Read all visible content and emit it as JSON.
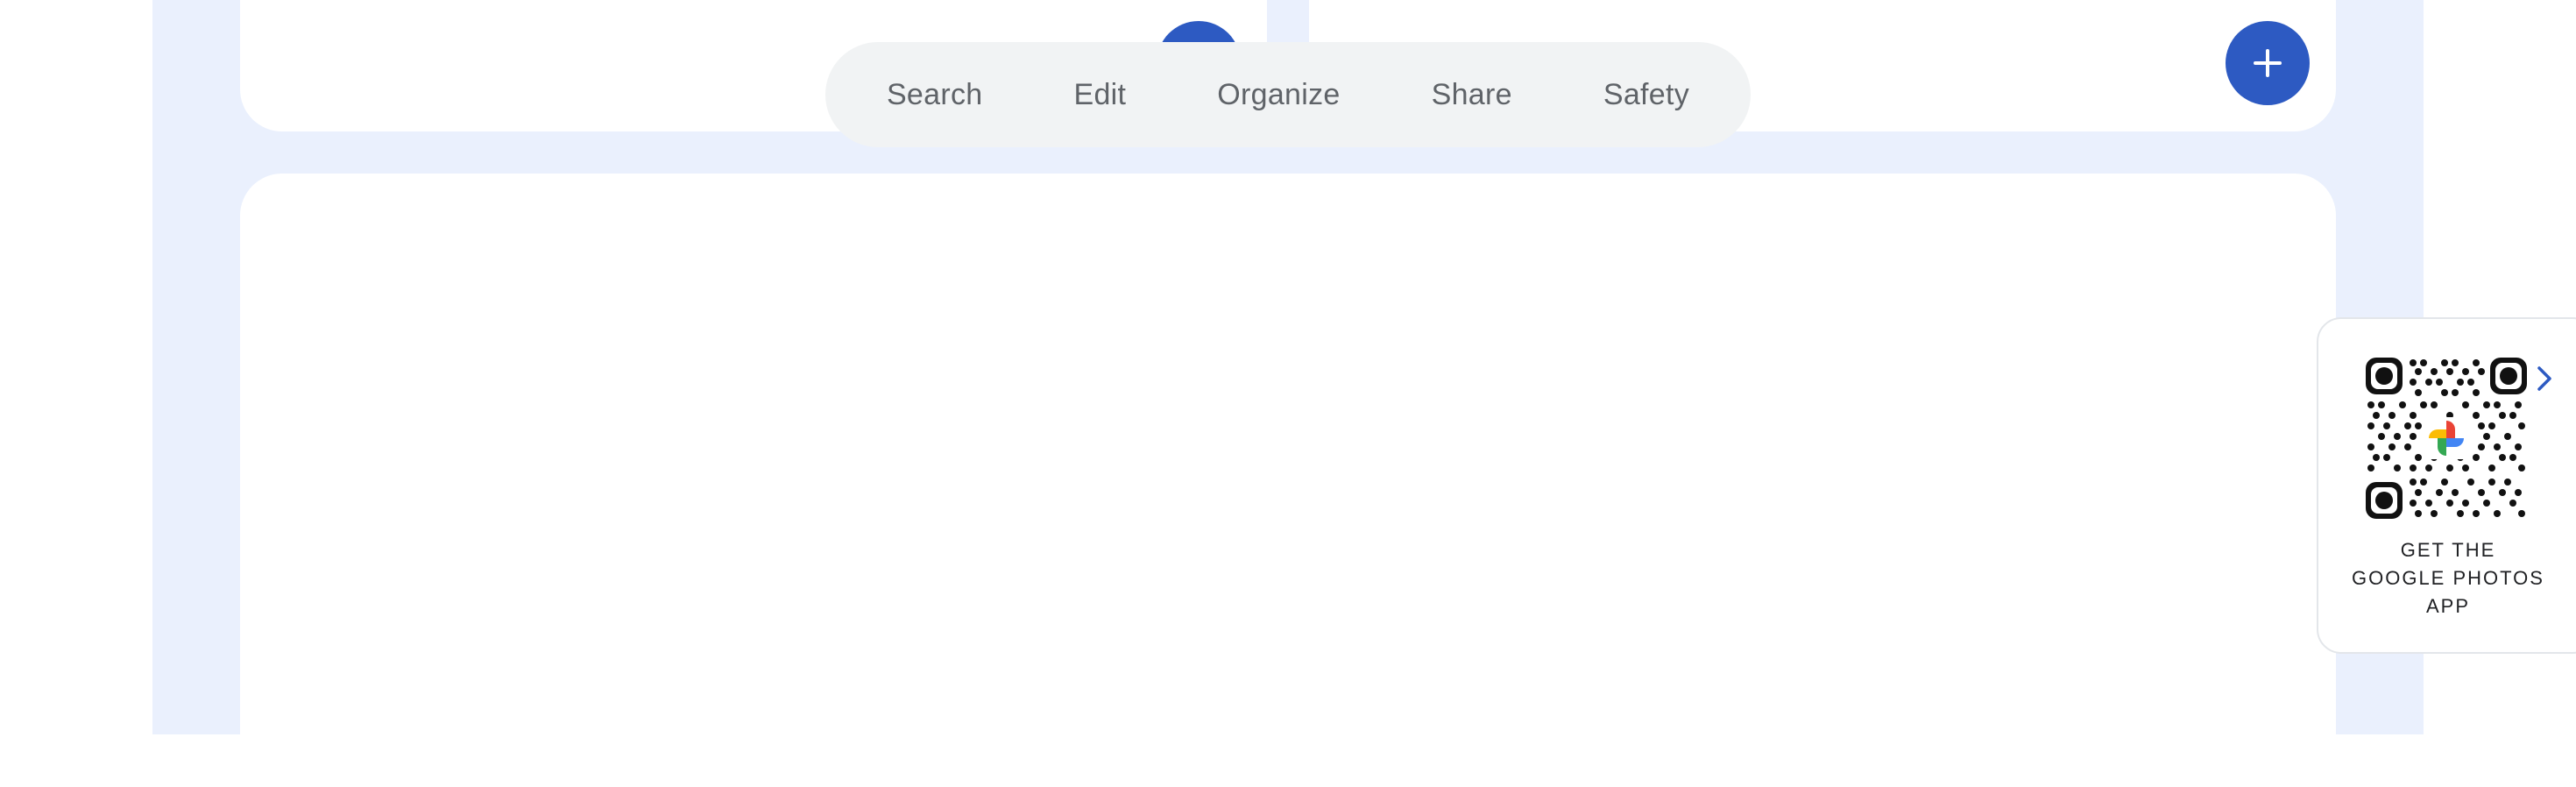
{
  "nav": {
    "tabs": [
      {
        "label": "Search"
      },
      {
        "label": "Edit"
      },
      {
        "label": "Organize"
      },
      {
        "label": "Share"
      },
      {
        "label": "Safety"
      }
    ]
  },
  "fab": {
    "icon": "plus-icon"
  },
  "promo": {
    "qr_icon": "qr-code-icon",
    "chevron_icon": "chevron-right-icon",
    "caption_lines": [
      "GET THE",
      "GOOGLE PHOTOS",
      "APP"
    ]
  },
  "colors": {
    "accent": "#2d5ac2",
    "panel_background": "#eaf0fd",
    "tabbar_background": "#f1f3f4",
    "tab_text": "#5f6368"
  }
}
